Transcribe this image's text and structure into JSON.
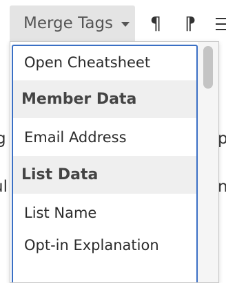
{
  "toolbar": {
    "merge_tags_label": "Merge Tags",
    "caret_icon": "caret-down-icon",
    "pilcrow_icon": "¶",
    "pilcrow_rtl_icon": "⁋"
  },
  "background_fragments": {
    "left_line_1": "g",
    "left_line_2": "ul",
    "right_line_1": "p",
    "right_line_2": "n"
  },
  "dropdown": {
    "items": [
      {
        "type": "item",
        "label": "Open Cheatsheet"
      },
      {
        "type": "heading",
        "label": "Member Data"
      },
      {
        "type": "item",
        "label": "Email Address"
      },
      {
        "type": "heading",
        "label": "List Data"
      },
      {
        "type": "item",
        "label": "List Name"
      },
      {
        "type": "item",
        "label": "Opt-in Explanation"
      }
    ]
  }
}
